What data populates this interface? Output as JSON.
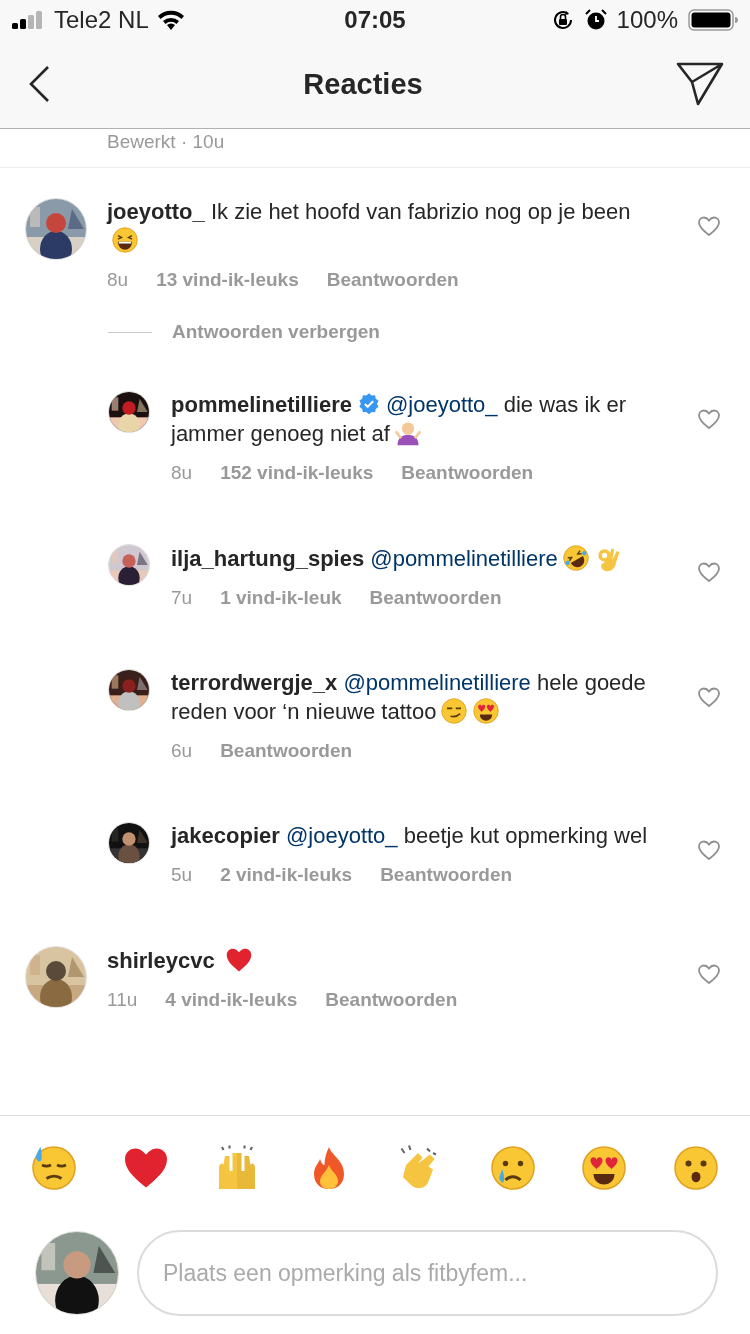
{
  "status_bar": {
    "carrier": "Tele2 NL",
    "time": "07:05",
    "battery": "100%"
  },
  "header": {
    "title": "Reacties"
  },
  "previous_meta": "Bewerkt · 10u",
  "comments": [
    {
      "user": "joeyotto_",
      "verified": false,
      "parts": [
        {
          "kind": "plain",
          "text": "Ik zie het hoofd van fabrizio nog op je been "
        },
        {
          "kind": "grin"
        }
      ],
      "time": "8u",
      "likes": "13 vind-ik-leuks",
      "reply": "Beantwoorden",
      "liked": false,
      "hide_replies": "Antwoorden verbergen",
      "replies": [
        {
          "user": "pommelinetilliere",
          "verified": true,
          "parts": [
            {
              "kind": "mention",
              "text": "@joeyotto_"
            },
            {
              "kind": "plain",
              "text": " die was ik er jammer genoeg niet af"
            },
            {
              "kind": "shrug"
            }
          ],
          "time": "8u",
          "likes": "152 vind-ik-leuks",
          "reply": "Beantwoorden",
          "liked": false
        },
        {
          "user": "ilja_hartung_spies",
          "verified": false,
          "parts": [
            {
              "kind": "mention",
              "text": "@pommelinetilliere"
            },
            {
              "kind": "rofl"
            },
            {
              "kind": "ok"
            }
          ],
          "time": "7u",
          "likes": "1 vind-ik-leuk",
          "reply": "Beantwoorden",
          "liked": false
        },
        {
          "user": "terrordwergje_x",
          "verified": false,
          "parts": [
            {
              "kind": "mention",
              "text": "@pommelinetilliere"
            },
            {
              "kind": "plain",
              "text": " hele goede reden voor ‘n nieuwe tattoo"
            },
            {
              "kind": "smirk"
            },
            {
              "kind": "hearteyes"
            }
          ],
          "time": "6u",
          "reply": "Beantwoorden",
          "liked": false
        },
        {
          "user": "jakecopier",
          "verified": false,
          "parts": [
            {
              "kind": "mention",
              "text": "@joeyotto_"
            },
            {
              "kind": "plain",
              "text": " beetje kut opmerking wel"
            }
          ],
          "time": "5u",
          "likes": "2 vind-ik-leuks",
          "reply": "Beantwoorden",
          "liked": false
        }
      ]
    },
    {
      "user": "shirleycvc",
      "verified": false,
      "parts": [
        {
          "kind": "heart"
        }
      ],
      "time": "11u",
      "likes": "4 vind-ik-leuks",
      "reply": "Beantwoorden",
      "liked": false
    }
  ],
  "reactions": [
    {
      "kind": "sweat"
    },
    {
      "kind": "heart"
    },
    {
      "kind": "raised"
    },
    {
      "kind": "fire"
    },
    {
      "kind": "clap"
    },
    {
      "kind": "cry"
    },
    {
      "kind": "hearteyes"
    },
    {
      "kind": "wow"
    }
  ],
  "composer": {
    "placeholder": "Plaats een opmerking als fitbyfem..."
  }
}
